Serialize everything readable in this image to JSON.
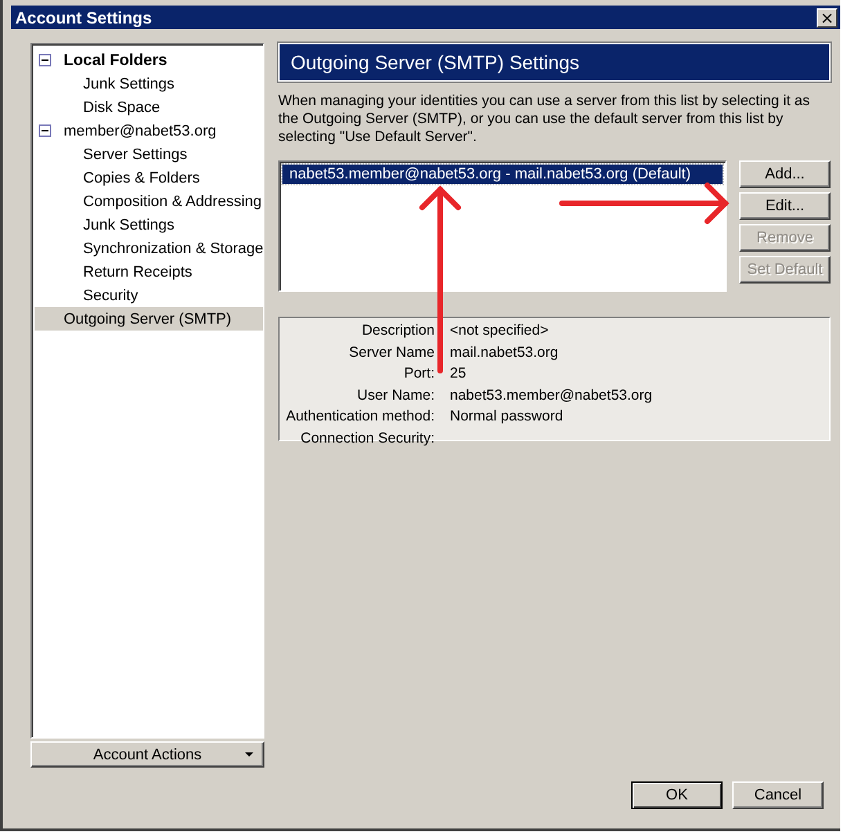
{
  "window": {
    "title": "Account Settings",
    "close": "×"
  },
  "sidebar": {
    "items": [
      {
        "label": "Local Folders",
        "bold": true,
        "expanded": true,
        "selected": false,
        "children": [
          {
            "label": "Junk Settings",
            "selected": false
          },
          {
            "label": "Disk Space",
            "selected": false
          }
        ]
      },
      {
        "label": "member@nabet53.org",
        "bold": false,
        "expanded": true,
        "selected": false,
        "children": [
          {
            "label": "Server Settings",
            "selected": false
          },
          {
            "label": "Copies & Folders",
            "selected": false
          },
          {
            "label": "Composition & Addressing",
            "selected": false
          },
          {
            "label": "Junk Settings",
            "selected": false
          },
          {
            "label": "Synchronization & Storage",
            "selected": false
          },
          {
            "label": "Return Receipts",
            "selected": false
          },
          {
            "label": "Security",
            "selected": false
          }
        ]
      },
      {
        "label": "Outgoing Server (SMTP)",
        "bold": false,
        "selected": true
      }
    ],
    "actions_button": "Account Actions"
  },
  "panel": {
    "title": "Outgoing Server (SMTP) Settings",
    "description": "When managing your identities you can use a server from this list by selecting it as the Outgoing Server (SMTP), or you can use the default server from this list by selecting \"Use Default Server\".",
    "servers": [
      {
        "label": "nabet53.member@nabet53.org - mail.nabet53.org (Default)",
        "selected": true
      }
    ],
    "buttons": [
      {
        "label": "Add...",
        "disabled": false
      },
      {
        "label": "Edit...",
        "disabled": false
      },
      {
        "label": "Remove",
        "disabled": true
      },
      {
        "label": "Set Default",
        "disabled": true
      }
    ],
    "details": [
      {
        "label": "Description",
        "value": "<not specified>"
      },
      {
        "label": "Server Name",
        "value": "mail.nabet53.org"
      },
      {
        "label": "Port:",
        "value": "25"
      },
      {
        "label": "User Name:",
        "value": "nabet53.member@nabet53.org"
      },
      {
        "label": "Authentication method:",
        "value": "Normal password"
      },
      {
        "label": "Connection Security:"
      }
    ]
  },
  "footer": {
    "buttons": [
      "OK",
      "Cancel"
    ]
  }
}
